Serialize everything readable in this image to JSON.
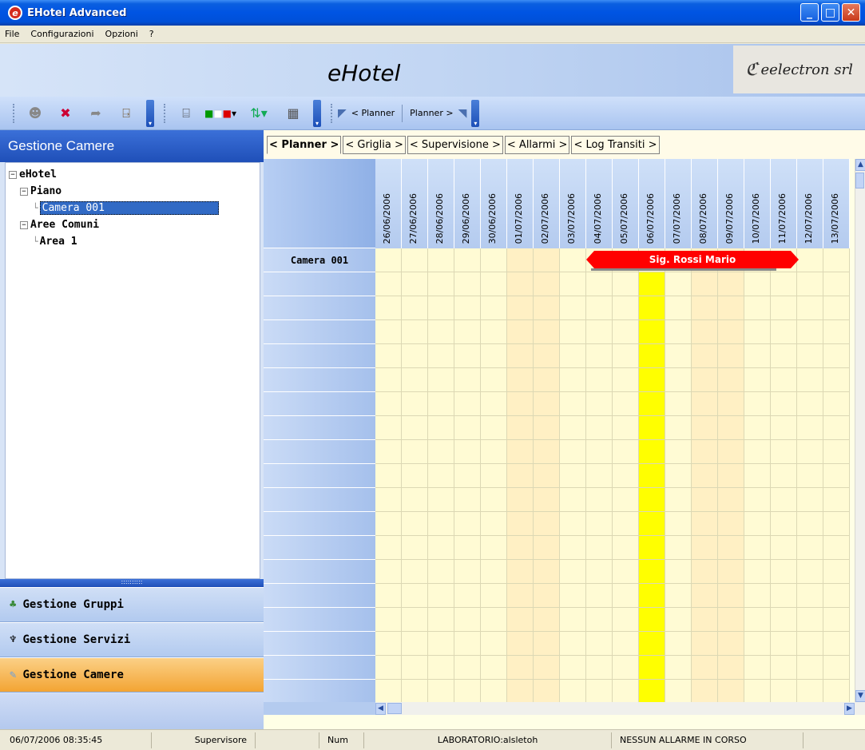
{
  "window": {
    "title": "EHotel Advanced",
    "icon": "app-logo-icon",
    "buttons": [
      "minimize",
      "maximize",
      "close"
    ]
  },
  "menu": [
    "File",
    "Configurazioni",
    "Opzioni",
    "?"
  ],
  "banner": {
    "app_name": "eHotel",
    "company": "eelectron srl"
  },
  "toolbar": {
    "icons": [
      "user-icon",
      "group-delete-icon",
      "user-edit-icon",
      "exit-door-icon",
      "card-icon",
      "italy-flag-icon",
      "sort-icon",
      "calendar-icon"
    ],
    "planner_prev": "< Planner",
    "planner_next": "Planner >"
  },
  "left_panel": {
    "header": "Gestione Camere",
    "tree": [
      {
        "label": "eHotel",
        "level": 0,
        "expander": "⊟"
      },
      {
        "label": "Piano",
        "level": 1,
        "expander": "⊟"
      },
      {
        "label": "Camera 001",
        "level": 2,
        "selected": true
      },
      {
        "label": "Aree Comuni",
        "level": 1,
        "expander": "⊟"
      },
      {
        "label": "Area 1",
        "level": 2
      }
    ],
    "splitter_grip": "::::::::::",
    "nav": [
      {
        "label": "Gestione Gruppi",
        "icon": "groups-icon",
        "active": false
      },
      {
        "label": "Gestione Servizi",
        "icon": "services-icon",
        "active": false
      },
      {
        "label": "Gestione Camere",
        "icon": "rooms-icon",
        "active": true
      }
    ]
  },
  "tabs": [
    "< Planner >",
    "< Griglia >",
    "< Supervisione >",
    "< Allarmi >",
    "< Log Transiti >"
  ],
  "active_tab": 0,
  "planner": {
    "dates": [
      "26/06/2006",
      "27/06/2006",
      "28/06/2006",
      "29/06/2006",
      "30/06/2006",
      "01/07/2006",
      "02/07/2006",
      "03/07/2006",
      "04/07/2006",
      "05/07/2006",
      "06/07/2006",
      "07/07/2006",
      "08/07/2006",
      "09/07/2006",
      "10/07/2006",
      "11/07/2006",
      "12/07/2006",
      "13/07/2006"
    ],
    "rooms": [
      "Camera 001"
    ],
    "booking": {
      "guest": "Sig. Rossi Mario",
      "from": "04/07/2006",
      "to": "11/07/2006",
      "color": "#ff0000"
    },
    "today": "06/07/2006",
    "today_color": "#ffff00"
  },
  "status": {
    "datetime": "06/07/2006 08:35:45",
    "user": "Supervisore",
    "num": "Num",
    "workstation": "LABORATORIO:alsletoh",
    "alarms": "NESSUN ALLARME IN CORSO"
  }
}
